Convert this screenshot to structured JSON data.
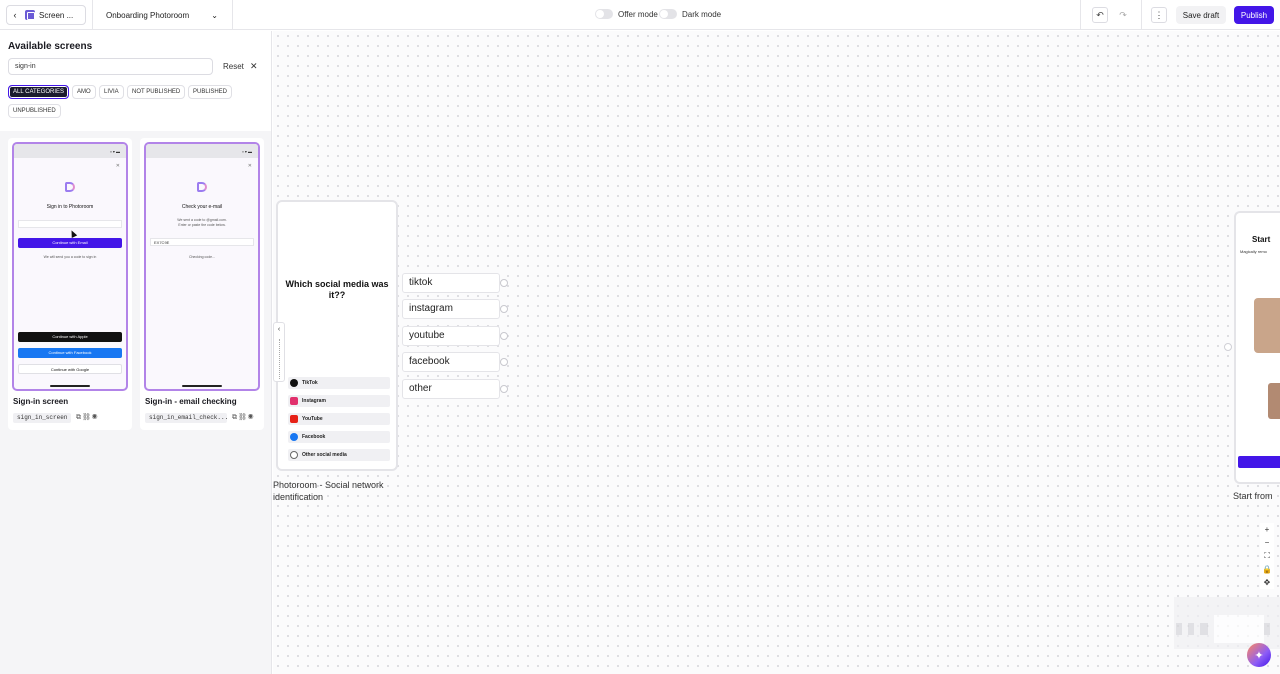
{
  "topbar": {
    "screen_button_label": "Screen ...",
    "flow_name": "Onboarding Photoroom",
    "offer_mode_label": "Offer mode",
    "dark_mode_label": "Dark mode",
    "save_draft_label": "Save draft",
    "publish_label": "Publish"
  },
  "sidebar": {
    "title": "Available screens",
    "search_value": "sign-in",
    "reset_label": "Reset",
    "categories": [
      "ALL CATEGORIES",
      "AMO",
      "LIVIA",
      "NOT PUBLISHED",
      "PUBLISHED",
      "UNPUBLISHED"
    ],
    "active_category": "ALL CATEGORIES",
    "cards": [
      {
        "name": "Sign-in screen",
        "id": "sign_in_screen",
        "preview": {
          "title": "Sign in to Photoroom",
          "primary_button": "Continue with Email",
          "note": "We will send you a code to sign in",
          "apple_button": "Continue with Apple",
          "facebook_button": "Continue with Facebook",
          "google_button": "Continue with Google"
        }
      },
      {
        "name": "Sign-in - email checking",
        "id": "sign_in_email_check...",
        "preview": {
          "title": "Check your e-mail",
          "line1": "We sent a code to                    @gmail.com.",
          "line2": "Enter or paste the code below.",
          "code": "EX7C9E",
          "status": "Checking code..."
        }
      }
    ]
  },
  "canvas": {
    "node": {
      "question": "Which social media was it??",
      "options": [
        "TikTok",
        "Instagram",
        "YouTube",
        "Facebook",
        "Other social media"
      ],
      "label": "Photoroom - Social network identification"
    },
    "connections": [
      "tiktok",
      "instagram",
      "youtube",
      "facebook",
      "other"
    ],
    "next_node": {
      "title": "Start",
      "subtitle": "Magically remo",
      "label": "Start from"
    },
    "zoom_controls": [
      "+",
      "−",
      "⛶",
      "🔒",
      "✥"
    ]
  },
  "colors": {
    "accent": "#4316e8",
    "phone_border": "#b284e8",
    "canvas_dot": "#d4d4da"
  }
}
